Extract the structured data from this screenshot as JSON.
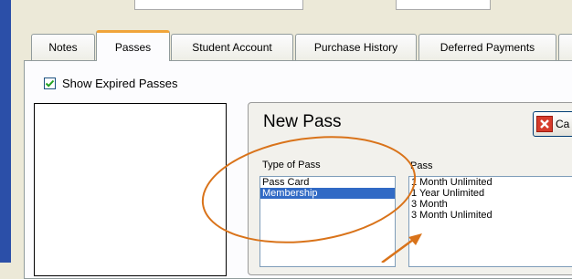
{
  "tabs": [
    {
      "label": "Notes"
    },
    {
      "label": "Passes"
    },
    {
      "label": "Student Account"
    },
    {
      "label": "Purchase History"
    },
    {
      "label": "Deferred Payments"
    }
  ],
  "options": {
    "show_expired_label": "Show Expired Passes",
    "show_expired_checked": true
  },
  "new_pass": {
    "title": "New Pass",
    "cancel_label": "Ca",
    "type_label": "Type of Pass",
    "pass_label": "Pass",
    "type_items": [
      "Pass Card",
      "Membership"
    ],
    "type_selected": "Membership",
    "pass_items": [
      "1 Month Unlimited",
      "1 Year Unlimited",
      "3 Month",
      "3 Month Unlimited"
    ]
  },
  "colors": {
    "annotation": "#d9731a",
    "selection": "#316ac5",
    "active_tab_accent": "#f0a43a"
  },
  "icons": {
    "checkbox": "check-icon",
    "cancel": "close-icon"
  }
}
